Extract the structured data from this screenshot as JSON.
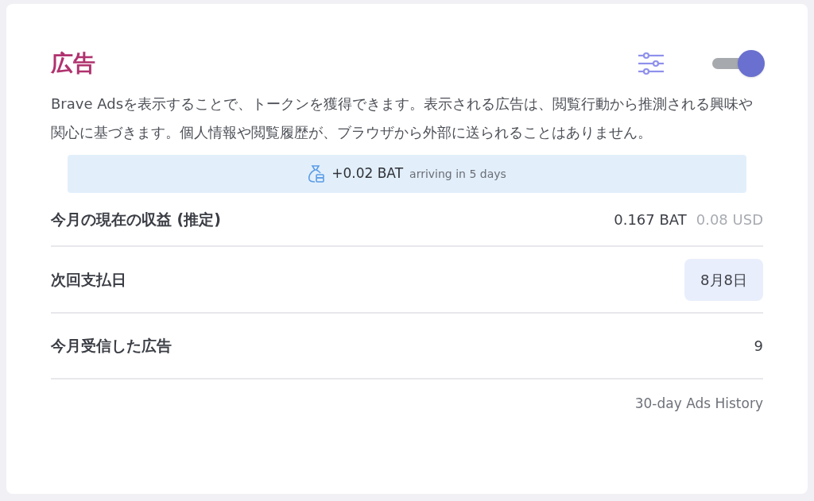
{
  "title": "広告",
  "toggle": {
    "on": true
  },
  "description": "Brave Adsを表示することで、トークンを獲得できます。表示される広告は、閲覧行動から推測される興味や関心に基づきます。個人情報や閲覧履歴が、ブラウザから外部に送られることはありません。",
  "notice": {
    "amount": "+0.02 BAT",
    "detail": "arriving in 5 days"
  },
  "rows": [
    {
      "kind": "amount",
      "label": "今月の現在の収益 (推定)",
      "value": "0.167 BAT",
      "secondary": "0.08 USD"
    },
    {
      "kind": "pill",
      "label": "次回支払日",
      "value": "8月8日"
    },
    {
      "kind": "plain",
      "label": "今月受信した広告",
      "value": "9"
    }
  ],
  "history_link": "30-day Ads History"
}
